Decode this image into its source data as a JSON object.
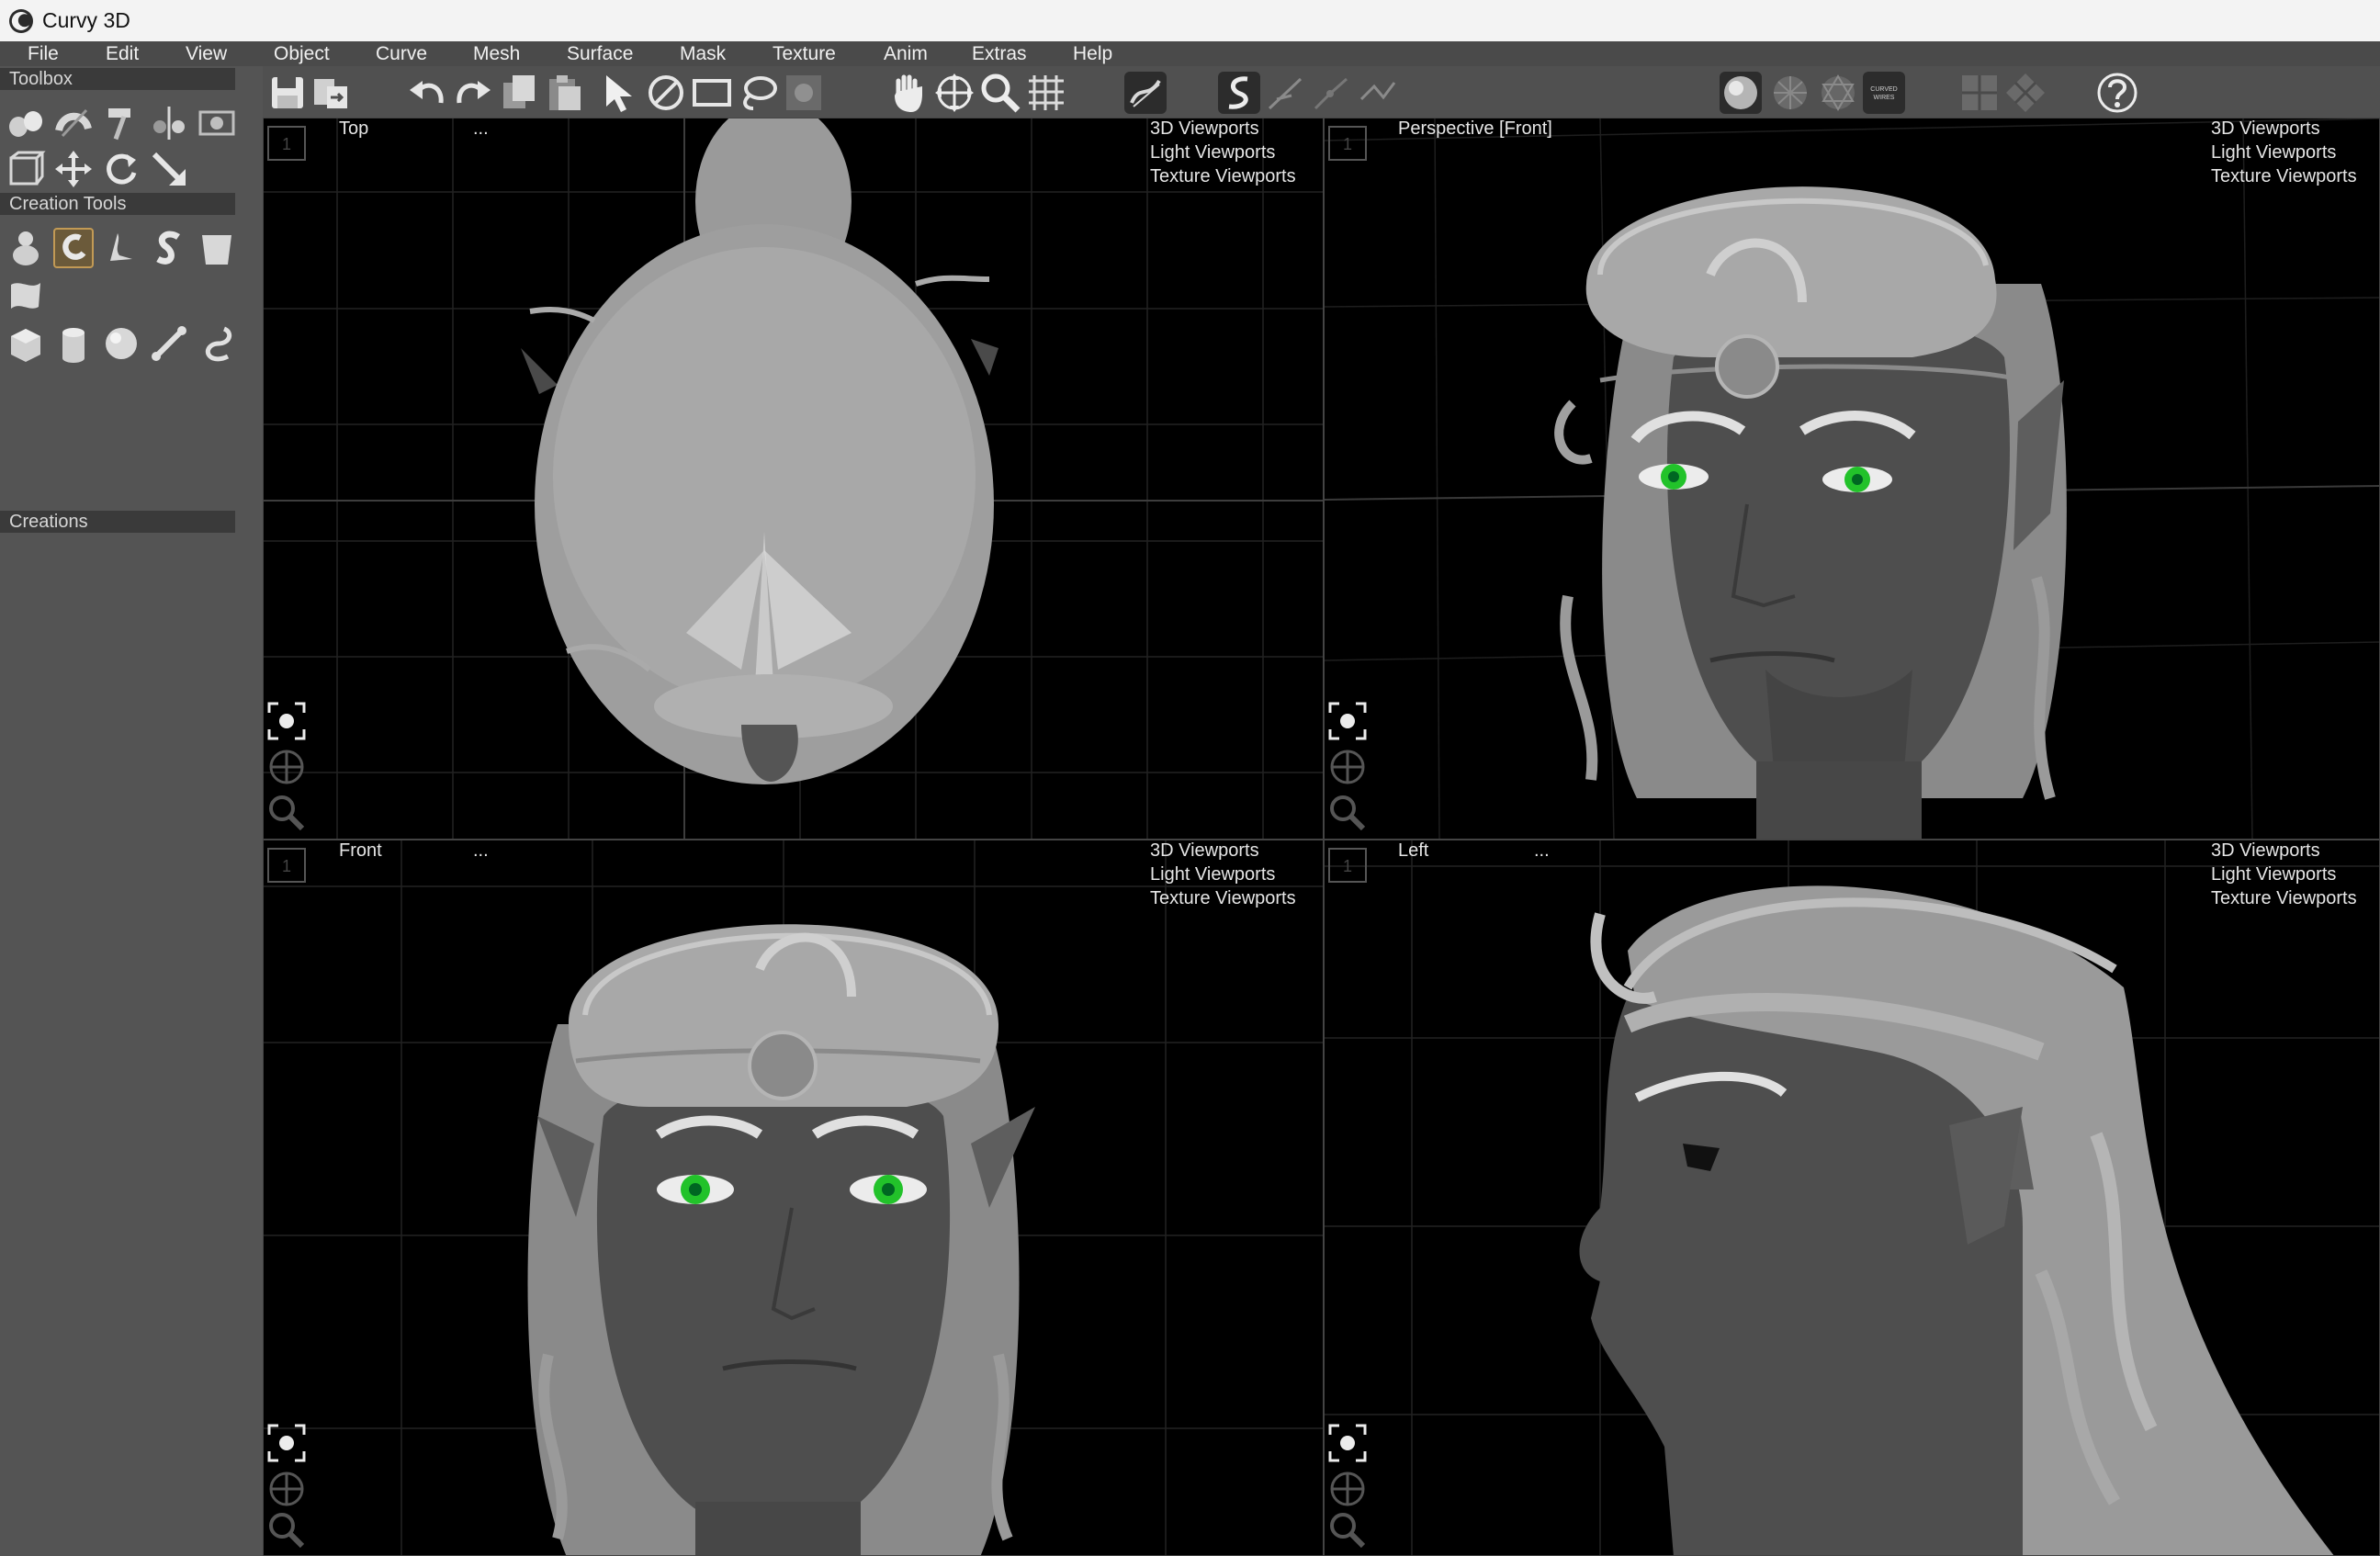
{
  "window": {
    "title": "Curvy 3D"
  },
  "menu": [
    "File",
    "Edit",
    "View",
    "Object",
    "Curve",
    "Mesh",
    "Surface",
    "Mask",
    "Texture",
    "Anim",
    "Extras",
    "Help"
  ],
  "left_panel": {
    "toolbox_label": "Toolbox",
    "creation_tools_label": "Creation Tools",
    "creations_label": "Creations"
  },
  "toolbar": {
    "curved_wires_label_line1": "CURVED",
    "curved_wires_label_line2": "WIRES"
  },
  "viewports": [
    {
      "name": "Top",
      "dots": "...",
      "menu": [
        "3D Viewports",
        "Light Viewports",
        "Texture Viewports"
      ],
      "number": "1"
    },
    {
      "name": "Perspective [Front]",
      "dots": "",
      "menu": [
        "3D Viewports",
        "Light Viewports",
        "Texture Viewports"
      ],
      "number": "1"
    },
    {
      "name": "Front",
      "dots": "...",
      "menu": [
        "3D Viewports",
        "Light Viewports",
        "Texture Viewports"
      ],
      "number": "1"
    },
    {
      "name": "Left",
      "dots": "...",
      "menu": [
        "3D Viewports",
        "Light Viewports",
        "Texture Viewports"
      ],
      "number": "1"
    }
  ],
  "colors": {
    "accent_active": "#c29a55",
    "eye_green": "#22c22a",
    "skin": "#555555",
    "hair": "#b0b0b0"
  }
}
